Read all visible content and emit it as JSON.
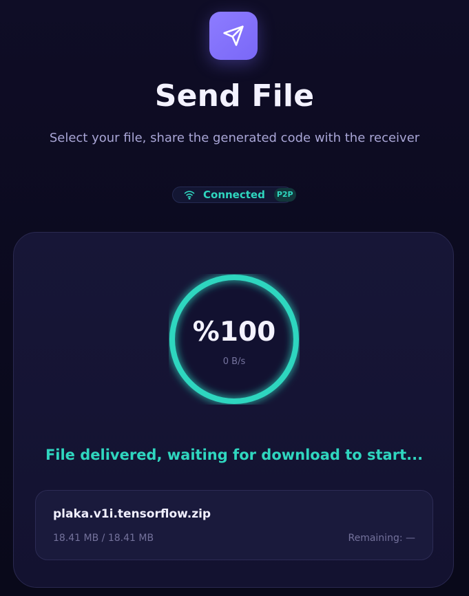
{
  "header": {
    "app_icon": "send-paper-plane-icon",
    "title": "Send File",
    "subtitle": "Select your file, share the generated code with the receiver"
  },
  "status": {
    "icon": "wifi-icon",
    "label": "Connected",
    "badge": "P2P",
    "color": "#2fd6bf"
  },
  "progress": {
    "value_text": "%100",
    "percent": 100,
    "speed": "0 B/s"
  },
  "message": "File delivered, waiting for download to start...",
  "file": {
    "name": "plaka.v1i.tensorflow.zip",
    "size": "18.41 MB / 18.41 MB",
    "remaining": "Remaining: —"
  },
  "colors": {
    "accent": "#2fd6bf",
    "brand": "#8374fb",
    "background": "#0d0c22"
  }
}
